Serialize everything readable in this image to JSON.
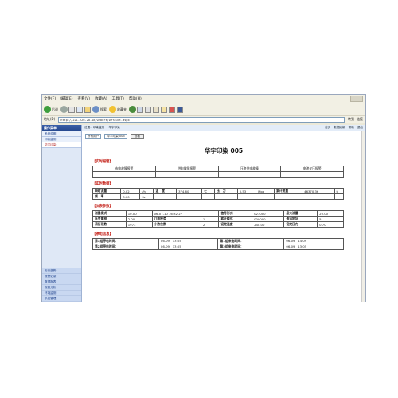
{
  "menu": {
    "items": [
      "文件(F)",
      "编辑(E)",
      "查看(V)",
      "收藏(A)",
      "工具(T)",
      "帮助(H)"
    ]
  },
  "toolbar": {
    "back": "后退",
    "search": "搜索",
    "favorites": "收藏夹"
  },
  "address": {
    "label": "地址(D)",
    "url": "http://221.226.20.18/webers/Default.aspx",
    "go": "转到",
    "links": "链接"
  },
  "sidebar": {
    "header": "操作菜单",
    "items": [
      "系统说明",
      "印染监测",
      "华宇印染"
    ],
    "bottom_items": [
      "历史趋势",
      "报警记录",
      "数据报表",
      "报表分析",
      "环境监测",
      "系统管理"
    ]
  },
  "tabbar": {
    "crumb": "位置：印染监测 → 华宇印染",
    "home": "首页",
    "refresh": "数据刷新",
    "help": "帮助",
    "exit": "退出"
  },
  "filter": {
    "select1": "所有用户",
    "select2": "华宇印染 005",
    "query": "查看"
  },
  "page": {
    "title": "华宇印染 005"
  },
  "sections": {
    "alarm": "【实时报警】",
    "realtime": "【实时数据】",
    "params": "【仪表参数】",
    "power": "【停电信息】"
  },
  "alarm_row": [
    "市电故障报警",
    "供电故障报警",
    "压变供电故障",
    "电池欠压报警"
  ],
  "realtime": {
    "r1": [
      "瞬时流量",
      "0.02",
      "t/h",
      "温　度",
      "374.60",
      "℃",
      "压　力",
      "0.53",
      "Mpa",
      "累计流量",
      "46370.36",
      "t"
    ],
    "r2": [
      "频　率",
      "3.00",
      "Hz"
    ]
  },
  "params": {
    "r1": [
      "测量模式",
      "10.00",
      "06-07-10 16:32:27",
      "信号形式",
      "021000",
      "最大流量",
      "20.00"
    ],
    "r2": [
      "压变量程",
      "2.00",
      "介质种类",
      "1",
      "累计模式",
      "000000",
      "通讯地址",
      "5"
    ],
    "r3": [
      "涡街系数",
      "1973",
      "小数位数",
      "2",
      "设定温度",
      "240.00",
      "设定压力",
      "0.70"
    ]
  },
  "power": {
    "r1": [
      "第1组停电时间：",
      "06-09　13:05",
      "第1组来电时间：",
      "06-09　14:09"
    ],
    "r2": [
      "第2组停电时间：",
      "06-09　13:05",
      "第2组来电时间：",
      "06-09　13:05"
    ]
  }
}
